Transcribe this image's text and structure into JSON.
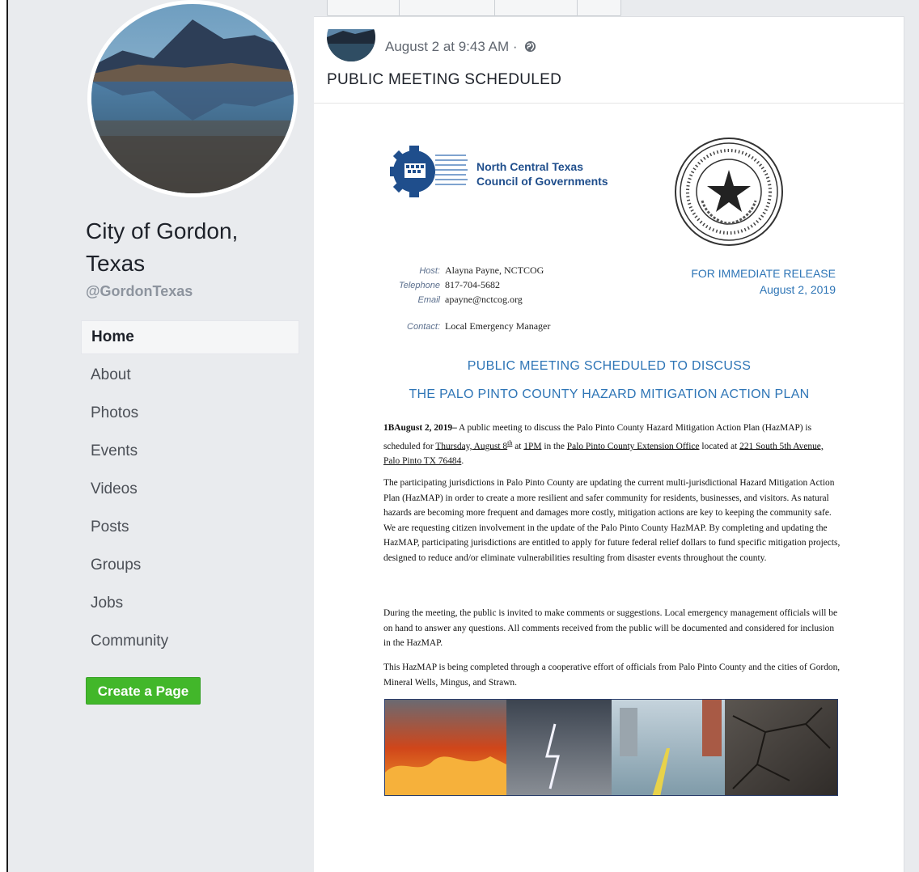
{
  "page": {
    "name": "City of Gordon, Texas",
    "name_line1": "City of Gordon,",
    "name_line2": "Texas",
    "handle": "@GordonTexas"
  },
  "nav": {
    "items": [
      "Home",
      "About",
      "Photos",
      "Events",
      "Videos",
      "Posts",
      "Groups",
      "Jobs",
      "Community"
    ],
    "active": "Home"
  },
  "create_page_label": "Create a Page",
  "post": {
    "timestamp": "August 2 at 9:43 AM ·",
    "title": "PUBLIC MEETING SCHEDULED"
  },
  "document": {
    "org_line1": "North Central Texas",
    "org_line2": "Council of Governments",
    "contact": {
      "host_label": "Host:",
      "host_value": "Alayna Payne, NCTCOG",
      "telephone_label": "Telephone",
      "telephone_value": "817-704-5682",
      "email_label": "Email",
      "email_value": "apayne@nctcog.org",
      "contact_label": "Contact:",
      "contact_value": "Local Emergency Manager"
    },
    "release_line1": "FOR IMMEDIATE RELEASE",
    "release_line2": "August 2, 2019",
    "headline1": "PUBLIC MEETING SCHEDULED TO DISCUSS",
    "headline2": "THE PALO PINTO COUNTY HAZARD MITIGATION ACTION PLAN",
    "para1_lead": "1BAugust 2, 2019–",
    "para1_a": " A public meeting to discuss the Palo Pinto County Hazard Mitigation Action Plan (HazMAP) is scheduled for ",
    "para1_date": "Thursday, August 8",
    "para1_th": "th",
    "para1_b": " at ",
    "para1_time": "1PM",
    "para1_c": " in the ",
    "para1_place": "Palo Pinto County Extension Office",
    "para1_d": " located at ",
    "para1_addr": "221 South 5th Avenue, Palo Pinto TX 76484",
    "para1_e": ".",
    "para2": "The participating jurisdictions in Palo Pinto County are updating the current multi-jurisdictional Hazard Mitigation Action Plan (HazMAP) in order to create a more resilient and safer community for residents, businesses, and visitors. As natural hazards are becoming more frequent and damages more costly, mitigation actions are key to keeping the community safe. We are requesting citizen involvement in the update of the Palo Pinto County HazMAP. By completing and updating the HazMAP, participating jurisdictions are entitled to apply for future federal relief dollars to fund specific mitigation projects, designed to reduce and/or eliminate vulnerabilities resulting from disaster events throughout the county.",
    "para3": "During the meeting, the public is invited to make comments or suggestions. Local emergency management officials will be on hand to answer any questions. All comments received from the public will be documented and considered for inclusion in the HazMAP.",
    "para4": "This HazMAP is being completed through a cooperative effort of officials from Palo Pinto County and the cities of Gordon, Mineral Wells, Mingus, and Strawn."
  },
  "colors": {
    "accent_green": "#42b72a",
    "doc_blue": "#2e75b6",
    "page_bg": "#e9ebee"
  }
}
